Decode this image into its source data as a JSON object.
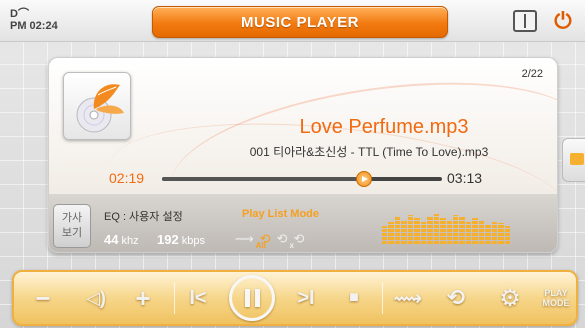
{
  "status": {
    "clock": "PM 02:24",
    "clock_icon": "D⌒"
  },
  "header": {
    "title": "MUSIC PLAYER"
  },
  "track": {
    "index": "2/22",
    "title": "Love Perfume.mp3",
    "subtitle": "001 티아라&초신성 - TTL (Time To Love).mp3",
    "current_time": "02:19",
    "total_time": "03:13",
    "progress": 0.72
  },
  "info": {
    "lyrics_button": "가사\n보기",
    "eq": "EQ : 사용자 설정",
    "freq_value": "44",
    "freq_unit": "khz",
    "bitrate_value": "192",
    "bitrate_unit": "kbps",
    "playlist_mode": "Play List Mode",
    "mode_all": "All",
    "mode_shuffle": "x"
  },
  "eq_levels": [
    0.55,
    0.7,
    0.85,
    0.75,
    0.9,
    0.8,
    0.7,
    0.85,
    0.95,
    0.8,
    0.75,
    0.9,
    0.85,
    0.7,
    0.8,
    0.75,
    0.6,
    0.7,
    0.65,
    0.55
  ],
  "controls": {
    "volume_down": "−",
    "volume_icon": "◁)",
    "volume_up": "+",
    "prev": "I<",
    "next": ">I",
    "stop": "■",
    "play_mode": "PLAY\nMODE"
  },
  "colors": {
    "accent": "#f26a10",
    "eq": "#f5b030"
  }
}
